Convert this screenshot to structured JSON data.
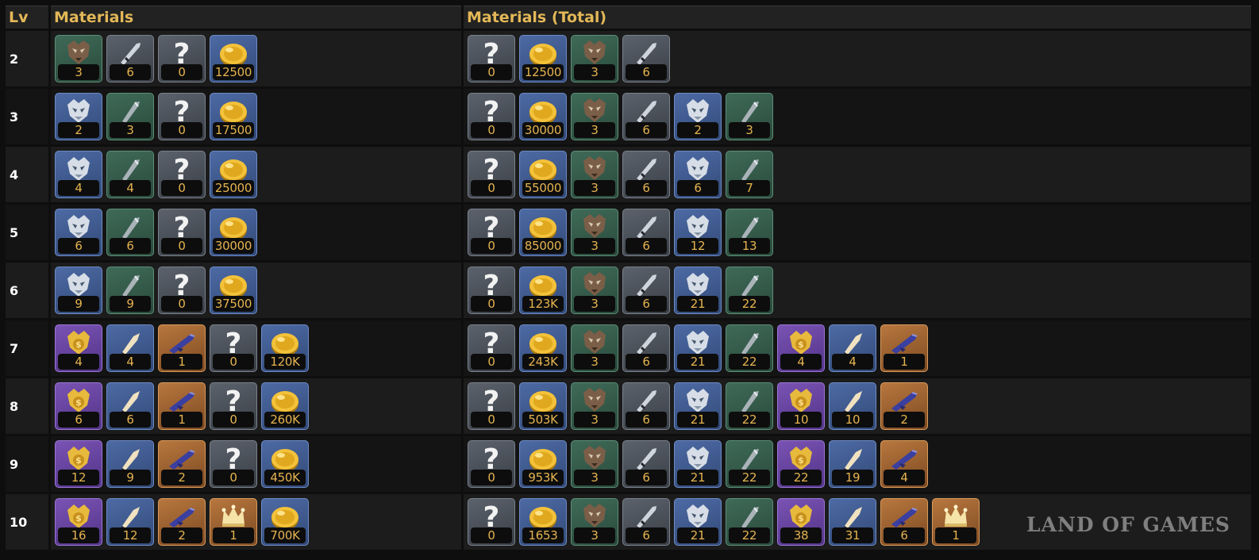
{
  "headers": {
    "lv": "Lv",
    "materials": "Materials",
    "total": "Materials (Total)"
  },
  "watermark": "LAND OF GAMES",
  "items": {
    "wolf_mask": {
      "icon": "wolf-mask-icon",
      "rarity": "green"
    },
    "dagger": {
      "icon": "dagger-icon",
      "rarity": "gray"
    },
    "unknown": {
      "icon": "question-mark-icon",
      "rarity": "gray"
    },
    "gold": {
      "icon": "gold-coin-icon",
      "rarity": "blue"
    },
    "silver_mask": {
      "icon": "silver-mask-icon",
      "rarity": "blue"
    },
    "blade_fragment": {
      "icon": "blade-fragment-icon",
      "rarity": "green"
    },
    "gold_mask": {
      "icon": "gold-mask-icon",
      "rarity": "purple"
    },
    "spearhead": {
      "icon": "spearhead-icon",
      "rarity": "blue"
    },
    "rifle": {
      "icon": "rifle-icon",
      "rarity": "orange"
    },
    "crown": {
      "icon": "crown-icon",
      "rarity": "orange"
    }
  },
  "rows": [
    {
      "lv": "2",
      "materials": [
        [
          "wolf_mask",
          "3"
        ],
        [
          "dagger",
          "6"
        ],
        [
          "unknown",
          "0"
        ],
        [
          "gold",
          "12500"
        ]
      ],
      "total": [
        [
          "unknown",
          "0"
        ],
        [
          "gold",
          "12500"
        ],
        [
          "wolf_mask",
          "3"
        ],
        [
          "dagger",
          "6"
        ]
      ]
    },
    {
      "lv": "3",
      "materials": [
        [
          "silver_mask",
          "2"
        ],
        [
          "blade_fragment",
          "3"
        ],
        [
          "unknown",
          "0"
        ],
        [
          "gold",
          "17500"
        ]
      ],
      "total": [
        [
          "unknown",
          "0"
        ],
        [
          "gold",
          "30000"
        ],
        [
          "wolf_mask",
          "3"
        ],
        [
          "dagger",
          "6"
        ],
        [
          "silver_mask",
          "2"
        ],
        [
          "blade_fragment",
          "3"
        ]
      ]
    },
    {
      "lv": "4",
      "materials": [
        [
          "silver_mask",
          "4"
        ],
        [
          "blade_fragment",
          "4"
        ],
        [
          "unknown",
          "0"
        ],
        [
          "gold",
          "25000"
        ]
      ],
      "total": [
        [
          "unknown",
          "0"
        ],
        [
          "gold",
          "55000"
        ],
        [
          "wolf_mask",
          "3"
        ],
        [
          "dagger",
          "6"
        ],
        [
          "silver_mask",
          "6"
        ],
        [
          "blade_fragment",
          "7"
        ]
      ]
    },
    {
      "lv": "5",
      "materials": [
        [
          "silver_mask",
          "6"
        ],
        [
          "blade_fragment",
          "6"
        ],
        [
          "unknown",
          "0"
        ],
        [
          "gold",
          "30000"
        ]
      ],
      "total": [
        [
          "unknown",
          "0"
        ],
        [
          "gold",
          "85000"
        ],
        [
          "wolf_mask",
          "3"
        ],
        [
          "dagger",
          "6"
        ],
        [
          "silver_mask",
          "12"
        ],
        [
          "blade_fragment",
          "13"
        ]
      ]
    },
    {
      "lv": "6",
      "materials": [
        [
          "silver_mask",
          "9"
        ],
        [
          "blade_fragment",
          "9"
        ],
        [
          "unknown",
          "0"
        ],
        [
          "gold",
          "37500"
        ]
      ],
      "total": [
        [
          "unknown",
          "0"
        ],
        [
          "gold",
          "123K"
        ],
        [
          "wolf_mask",
          "3"
        ],
        [
          "dagger",
          "6"
        ],
        [
          "silver_mask",
          "21"
        ],
        [
          "blade_fragment",
          "22"
        ]
      ]
    },
    {
      "lv": "7",
      "materials": [
        [
          "gold_mask",
          "4"
        ],
        [
          "spearhead",
          "4"
        ],
        [
          "rifle",
          "1"
        ],
        [
          "unknown",
          "0"
        ],
        [
          "gold",
          "120K"
        ]
      ],
      "total": [
        [
          "unknown",
          "0"
        ],
        [
          "gold",
          "243K"
        ],
        [
          "wolf_mask",
          "3"
        ],
        [
          "dagger",
          "6"
        ],
        [
          "silver_mask",
          "21"
        ],
        [
          "blade_fragment",
          "22"
        ],
        [
          "gold_mask",
          "4"
        ],
        [
          "spearhead",
          "4"
        ],
        [
          "rifle",
          "1"
        ]
      ]
    },
    {
      "lv": "8",
      "materials": [
        [
          "gold_mask",
          "6"
        ],
        [
          "spearhead",
          "6"
        ],
        [
          "rifle",
          "1"
        ],
        [
          "unknown",
          "0"
        ],
        [
          "gold",
          "260K"
        ]
      ],
      "total": [
        [
          "unknown",
          "0"
        ],
        [
          "gold",
          "503K"
        ],
        [
          "wolf_mask",
          "3"
        ],
        [
          "dagger",
          "6"
        ],
        [
          "silver_mask",
          "21"
        ],
        [
          "blade_fragment",
          "22"
        ],
        [
          "gold_mask",
          "10"
        ],
        [
          "spearhead",
          "10"
        ],
        [
          "rifle",
          "2"
        ]
      ]
    },
    {
      "lv": "9",
      "materials": [
        [
          "gold_mask",
          "12"
        ],
        [
          "spearhead",
          "9"
        ],
        [
          "rifle",
          "2"
        ],
        [
          "unknown",
          "0"
        ],
        [
          "gold",
          "450K"
        ]
      ],
      "total": [
        [
          "unknown",
          "0"
        ],
        [
          "gold",
          "953K"
        ],
        [
          "wolf_mask",
          "3"
        ],
        [
          "dagger",
          "6"
        ],
        [
          "silver_mask",
          "21"
        ],
        [
          "blade_fragment",
          "22"
        ],
        [
          "gold_mask",
          "22"
        ],
        [
          "spearhead",
          "19"
        ],
        [
          "rifle",
          "4"
        ]
      ]
    },
    {
      "lv": "10",
      "materials": [
        [
          "gold_mask",
          "16"
        ],
        [
          "spearhead",
          "12"
        ],
        [
          "rifle",
          "2"
        ],
        [
          "crown",
          "1"
        ],
        [
          "gold",
          "700K"
        ]
      ],
      "total": [
        [
          "unknown",
          "0"
        ],
        [
          "gold",
          "1653"
        ],
        [
          "wolf_mask",
          "3"
        ],
        [
          "dagger",
          "6"
        ],
        [
          "silver_mask",
          "21"
        ],
        [
          "blade_fragment",
          "22"
        ],
        [
          "gold_mask",
          "38"
        ],
        [
          "spearhead",
          "31"
        ],
        [
          "rifle",
          "6"
        ],
        [
          "crown",
          "1"
        ]
      ]
    }
  ]
}
